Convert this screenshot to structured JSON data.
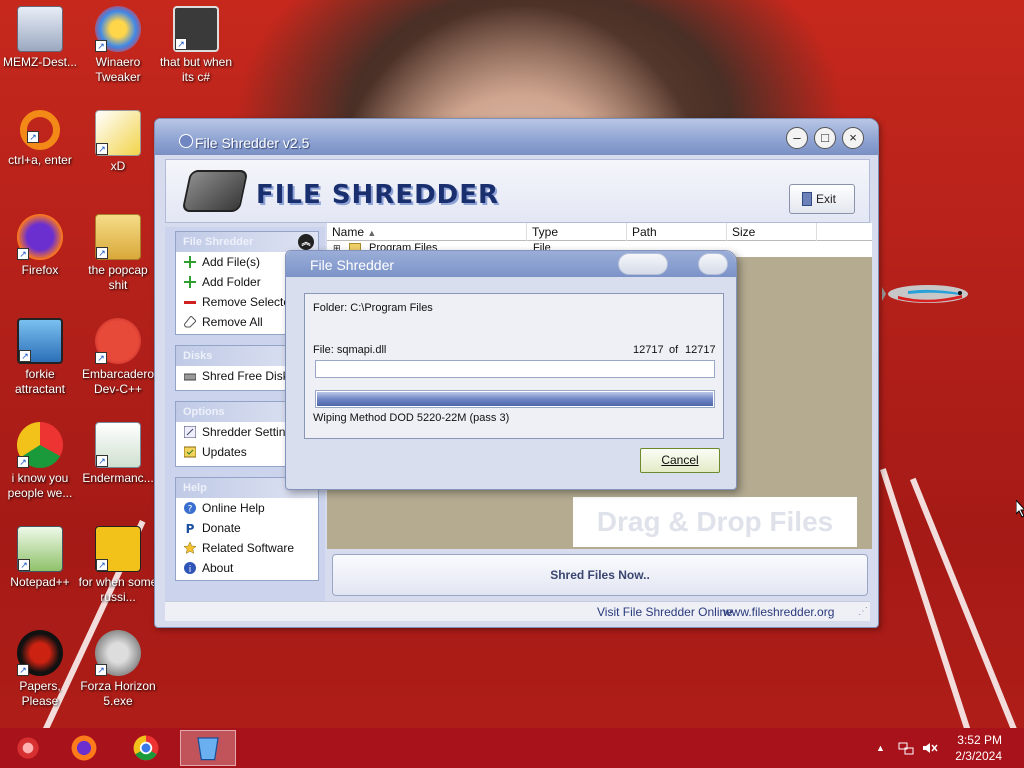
{
  "desktop": {
    "icons": [
      {
        "label": "MEMZ-Dest...",
        "icon": "recycle-bin-icon"
      },
      {
        "label": "Winaero Tweaker",
        "icon": "winaero-icon"
      },
      {
        "label": "that but when its c#",
        "icon": "stack-icon"
      },
      {
        "label": "ctrl+a, enter",
        "icon": "ring-icon"
      },
      {
        "label": "xD",
        "icon": "hxd-icon"
      },
      {
        "label": "Firefox",
        "icon": "firefox-icon"
      },
      {
        "label": "the popcap shit",
        "icon": "folder-icon"
      },
      {
        "label": "forkie attractant",
        "icon": "settings-monitor-icon"
      },
      {
        "label": "Embarcadero Dev-C++",
        "icon": "devcpp-icon"
      },
      {
        "label": "i know you people we...",
        "icon": "chrome-icon"
      },
      {
        "label": "Endermanc...",
        "icon": "window-icon"
      },
      {
        "label": "Notepad++",
        "icon": "notepadpp-icon"
      },
      {
        "label": "for when some russi...",
        "icon": "de-icon"
      },
      {
        "label": "Papers, Please",
        "icon": "papers-please-icon"
      },
      {
        "label": "Forza Horizon 5.exe",
        "icon": "flash-icon"
      }
    ]
  },
  "window": {
    "title": "File Shredder v2.5",
    "logo_text": "FILE SHREDDER",
    "exit_label": "Exit",
    "groups": {
      "file_shredder": {
        "title": "File Shredder",
        "items": [
          "Add File(s)",
          "Add Folder",
          "Remove Selected",
          "Remove All"
        ]
      },
      "disks": {
        "title": "Disks",
        "items": [
          "Shred Free Disk Space"
        ]
      },
      "options": {
        "title": "Options",
        "items": [
          "Shredder Settings",
          "Updates"
        ]
      },
      "help": {
        "title": "Help",
        "items": [
          "Online Help",
          "Donate",
          "Related Software",
          "About"
        ]
      }
    },
    "list": {
      "columns": [
        "Name",
        "Type",
        "Path",
        "Size"
      ],
      "rows": [
        {
          "name": "Program Files",
          "type": "File"
        }
      ],
      "drag_hint": "Drag & Drop Files Here"
    },
    "shred_button": "Shred Files Now..",
    "status": {
      "visit_label": "Visit File Shredder Online",
      "url": "www.fileshredder.org"
    }
  },
  "dialog": {
    "title": "File Shredder",
    "folder_text": "Folder: C:\\Program Files",
    "file_text": "File: sqmapi.dll",
    "count_current": "12717",
    "count_of": "of",
    "count_total": "12717",
    "file_progress": 0.0,
    "overall_progress": 1.0,
    "method_text": "Wiping Method DOD 5220-22M  (pass 3)",
    "cancel_label": "Cancel"
  },
  "taskbar": {
    "items": [
      "memz-icon",
      "firefox-icon",
      "chrome-icon",
      "file-shredder-icon"
    ],
    "active_index": 3,
    "time": "3:52 PM",
    "date": "2/3/2024"
  }
}
